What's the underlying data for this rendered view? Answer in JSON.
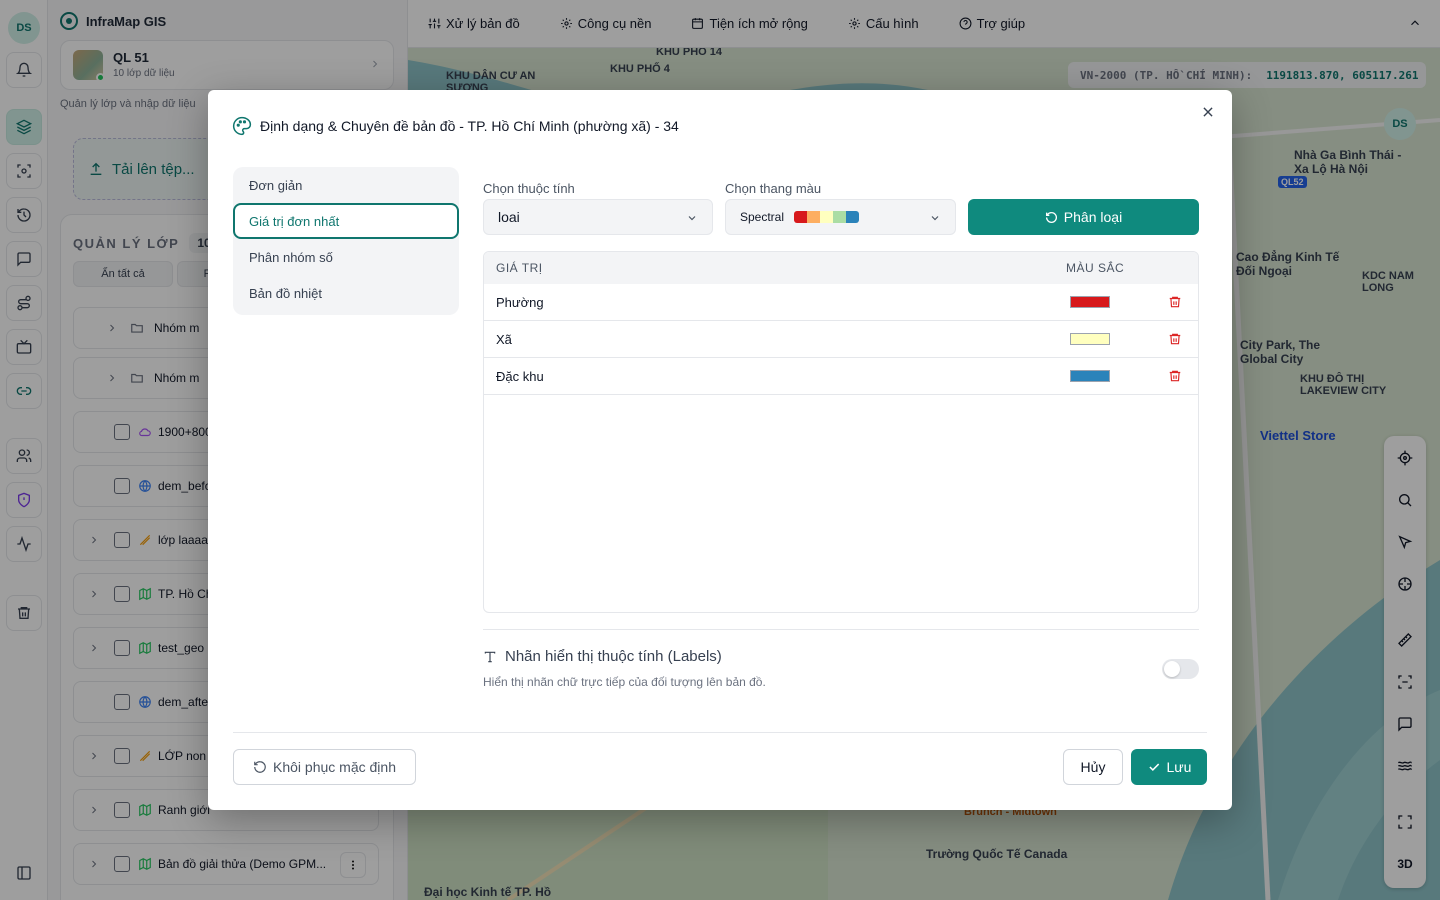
{
  "user": {
    "initials": "DS"
  },
  "app": {
    "name": "InfraMap GIS"
  },
  "project": {
    "name": "QL 51",
    "layers": "10 lớp dữ liệu",
    "subtitle": "Quản lý lớp và nhập dữ liệu"
  },
  "upload": {
    "label": "Tải lên tệp..."
  },
  "layer_panel": {
    "title": "QUẢN LÝ LỚP",
    "count": "10",
    "hide_all": "Ẩn tất cả",
    "second_button": "F",
    "rows": [
      {
        "name": "Nhóm m",
        "type": "folder"
      },
      {
        "name": "Nhóm m",
        "type": "folder"
      },
      {
        "name": "1900+800",
        "type": "cloud"
      },
      {
        "name": "dem_befo",
        "type": "globe"
      },
      {
        "name": "lớp laaaa",
        "type": "line"
      },
      {
        "name": "TP. Hồ Ch",
        "type": "polygon"
      },
      {
        "name": "test_geo",
        "type": "polygon"
      },
      {
        "name": "dem_afte",
        "type": "globe"
      },
      {
        "name": "LỚP non",
        "type": "line"
      },
      {
        "name": "Ranh giới",
        "type": "polygon"
      },
      {
        "name": "Bản đồ giải thửa (Demo GPM...",
        "type": "polygon"
      }
    ]
  },
  "toolbar": {
    "items": [
      "Xử lý bản đồ",
      "Công cụ nền",
      "Tiện ích mở rộng",
      "Cấu hình",
      "Trợ giúp"
    ]
  },
  "coord": {
    "system": "VN-2000 (TP. HỒ CHÍ MINH):",
    "value": "1191813.870, 605117.261"
  },
  "map_labels": [
    "KHU PHỐ 14",
    "KHU PHỐ 4",
    "KHU DÂN CƯ AN SƯƠNG",
    "Nhà Ga Bình Thái - Xa Lộ Hà Nội",
    "Cao Đẳng Kinh Tế Đối Ngoại",
    "KDC NAM LONG",
    "City Park, The Global City",
    "KHU ĐÔ THỊ LAKEVIEW CITY",
    "Viettel Store",
    "Brunch - Midtown",
    "Trường Quốc Tế Canada",
    "Đại học Kinh tế TP. Hồ",
    "QL52",
    "3D"
  ],
  "modal": {
    "title": "Định dạng & Chuyên đề bản đồ - TP. Hồ Chí Minh (phường xã) - 34",
    "tabs": [
      "Đơn giản",
      "Giá trị đơn nhất",
      "Phân nhóm số",
      "Bản đồ nhiệt"
    ],
    "active_tab": "Giá trị đơn nhất",
    "attribute_label": "Chọn thuộc tính",
    "attribute_value": "loai",
    "ramp_label": "Chọn thang màu",
    "ramp_value": "Spectral",
    "ramp_colors": [
      "#d7191c",
      "#fdae61",
      "#ffffbf",
      "#abdda4",
      "#2b83ba"
    ],
    "classify_button": "Phân loại",
    "table": {
      "col_value": "GIÁ TRỊ",
      "col_color": "MÀU SẮC",
      "rows": [
        {
          "value": "Phường",
          "color": "#d7191c"
        },
        {
          "value": "Xã",
          "color": "#ffffbf"
        },
        {
          "value": "Đặc khu",
          "color": "#2b83ba"
        }
      ]
    },
    "labels_title": "Nhãn hiển thị thuộc tính (Labels)",
    "labels_desc": "Hiển thị nhãn chữ trực tiếp của đối tượng lên bản đồ.",
    "labels_enabled": false,
    "reset_button": "Khôi phục mặc định",
    "cancel_button": "Hủy",
    "save_button": "Lưu"
  }
}
